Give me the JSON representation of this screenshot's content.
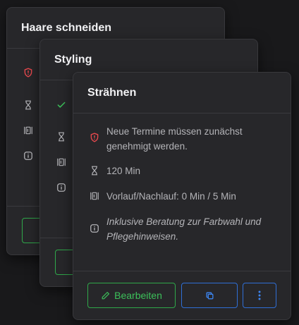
{
  "cards": [
    {
      "title": "Haare schneiden"
    },
    {
      "title": "Styling"
    },
    {
      "title": "Strähnen",
      "approval_note": "Neue Termine müssen zunächst genehmigt werden.",
      "duration": "120 Min",
      "buffer": "Vorlauf/Nachlauf: 0 Min / 5 Min",
      "description": "Inklusive Beratung zur Farbwahl und Pflegehinweisen.",
      "edit_label": "Bearbeiten"
    }
  ],
  "colors": {
    "approval_icon": "#e5484d",
    "success_icon": "#3cc05a",
    "edit_button": "#2fa84a",
    "secondary_button": "#2f6fd6"
  },
  "icons": [
    "shield-alert-icon",
    "check-icon",
    "hourglass-icon",
    "buffer-icon",
    "info-icon",
    "pencil-icon",
    "copy-icon",
    "more-vertical-icon"
  ]
}
